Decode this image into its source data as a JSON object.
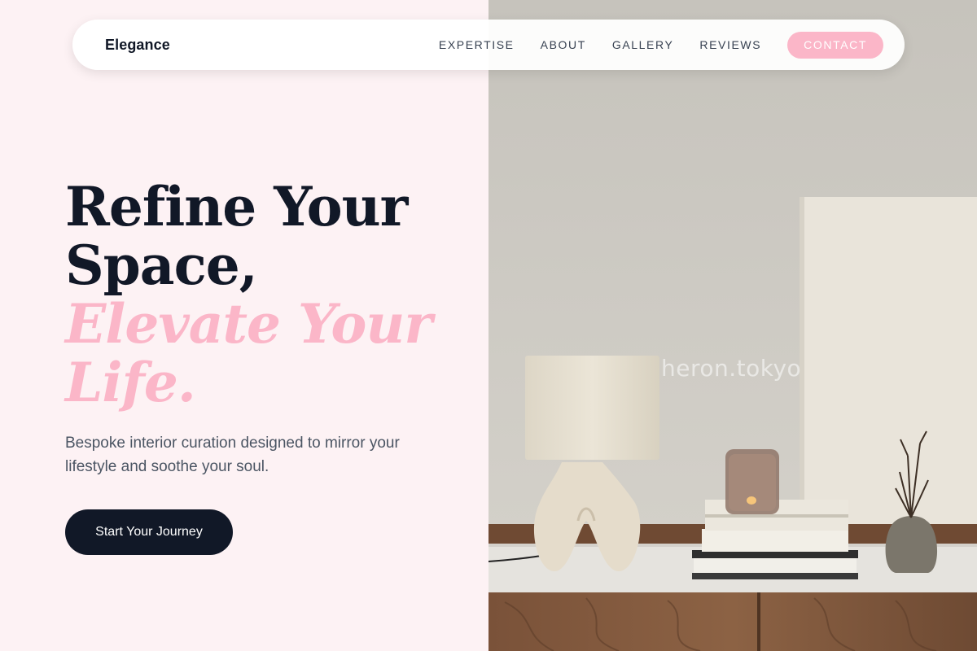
{
  "nav": {
    "brand": "Elegance",
    "links": [
      "EXPERTISE",
      "ABOUT",
      "GALLERY",
      "REVIEWS"
    ],
    "contact": "CONTACT"
  },
  "hero": {
    "line1": "Refine Your",
    "line2": "Space,",
    "line3": "Elevate Your",
    "line4": "Life.",
    "subtitle": "Bespoke interior curation designed to mirror your lifestyle and soothe your soul.",
    "cta": "Start Your Journey"
  },
  "image": {
    "watermark": "heron.tokyo"
  },
  "colors": {
    "accent_pink": "#fbb6c8",
    "dark": "#111827",
    "background": "#fdf2f4"
  }
}
